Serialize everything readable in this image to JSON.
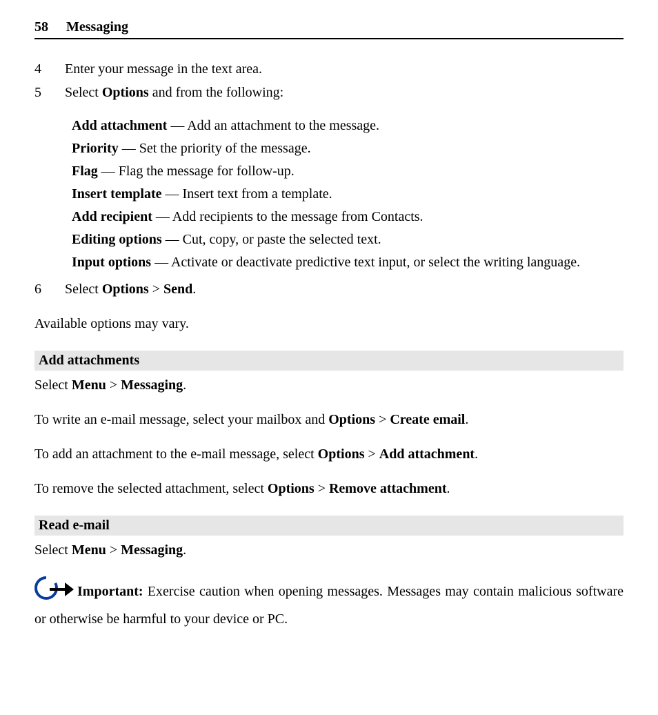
{
  "header": {
    "pageNumber": "58",
    "title": "Messaging"
  },
  "steps": {
    "s4": {
      "num": "4",
      "text": "Enter your message in the text area."
    },
    "s5": {
      "num": "5",
      "prefix": "Select ",
      "bold": "Options",
      "suffix": " and from the following:"
    },
    "s6": {
      "num": "6",
      "prefix": "Select ",
      "b1": "Options",
      "gt": " > ",
      "b2": "Send",
      "suffix": "."
    }
  },
  "options": {
    "o1": {
      "term": "Add attachment",
      "desc": "  — Add an attachment to the message."
    },
    "o2": {
      "term": "Priority",
      "desc": "  — Set the priority of the message."
    },
    "o3": {
      "term": "Flag",
      "desc": "  — Flag the message for follow-up."
    },
    "o4": {
      "term": "Insert template",
      "desc": "  — Insert text from a template."
    },
    "o5": {
      "term": "Add recipient",
      "desc": "  — Add recipients to the message from Contacts."
    },
    "o6": {
      "term": "Editing options",
      "desc": "  — Cut, copy, or paste the selected text."
    },
    "o7": {
      "term": "Input options",
      "desc": "  — Activate or deactivate predictive text input, or select the writing language."
    }
  },
  "note": "Available options may vary.",
  "sec1": {
    "title": "Add attachments",
    "p1": {
      "a": "Select ",
      "b1": "Menu",
      "gt": " > ",
      "b2": "Messaging",
      "z": "."
    },
    "p2": {
      "a": "To write an e-mail message, select your mailbox and ",
      "b1": "Options",
      "gt": " > ",
      "b2": "Create email",
      "z": "."
    },
    "p3": {
      "a": "To add an attachment to the e-mail message, select ",
      "b1": "Options",
      "gt": " > ",
      "b2": "Add attachment",
      "z": "."
    },
    "p4": {
      "a": "To remove the selected attachment, select ",
      "b1": "Options",
      "gt": " > ",
      "b2": "Remove attachment",
      "z": "."
    }
  },
  "sec2": {
    "title": "Read e-mail",
    "p1": {
      "a": "Select ",
      "b1": "Menu",
      "gt": " > ",
      "b2": "Messaging",
      "z": "."
    },
    "important": {
      "label": "Important: ",
      "text": "Exercise caution when opening messages. Messages may contain malicious software or otherwise be harmful to your device or PC."
    }
  }
}
